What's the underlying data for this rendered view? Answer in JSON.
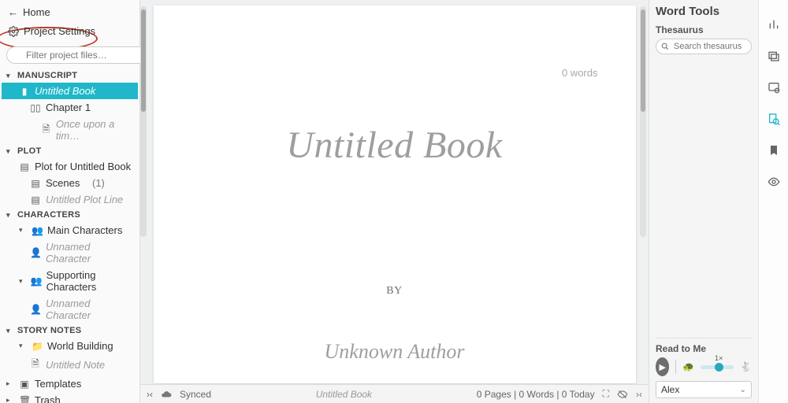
{
  "sidebar": {
    "home_label": "Home",
    "settings_label": "Project Settings",
    "filter_placeholder": "Filter project files…",
    "sections": {
      "manuscript": {
        "label": "MANUSCRIPT",
        "book": "Untitled Book",
        "chapter": "Chapter 1",
        "scene": "Once upon a tim…"
      },
      "plot": {
        "label": "PLOT",
        "plot_for": "Plot for Untitled Book",
        "scenes_label": "Scenes",
        "scenes_count": "(1)",
        "plot_line": "Untitled Plot Line"
      },
      "characters": {
        "label": "CHARACTERS",
        "main": "Main Characters",
        "supporting": "Supporting Characters",
        "unnamed": "Unnamed Character"
      },
      "story_notes": {
        "label": "STORY NOTES",
        "world_building": "World Building",
        "note": "Untitled Note"
      },
      "templates": "Templates",
      "trash": "Trash"
    }
  },
  "document": {
    "word_count": "0 words",
    "title": "Untitled Book",
    "by": "BY",
    "author": "Unknown Author"
  },
  "statusbar": {
    "synced": "Synced",
    "doc_name": "Untitled Book",
    "stats": "0 Pages | 0 Words | 0 Today"
  },
  "right_panel": {
    "title": "Word Tools",
    "thesaurus_label": "Thesaurus",
    "thesaurus_placeholder": "Search thesaurus",
    "read_to_me": "Read to Me",
    "speed_label": "1×",
    "voice": "Alex"
  }
}
